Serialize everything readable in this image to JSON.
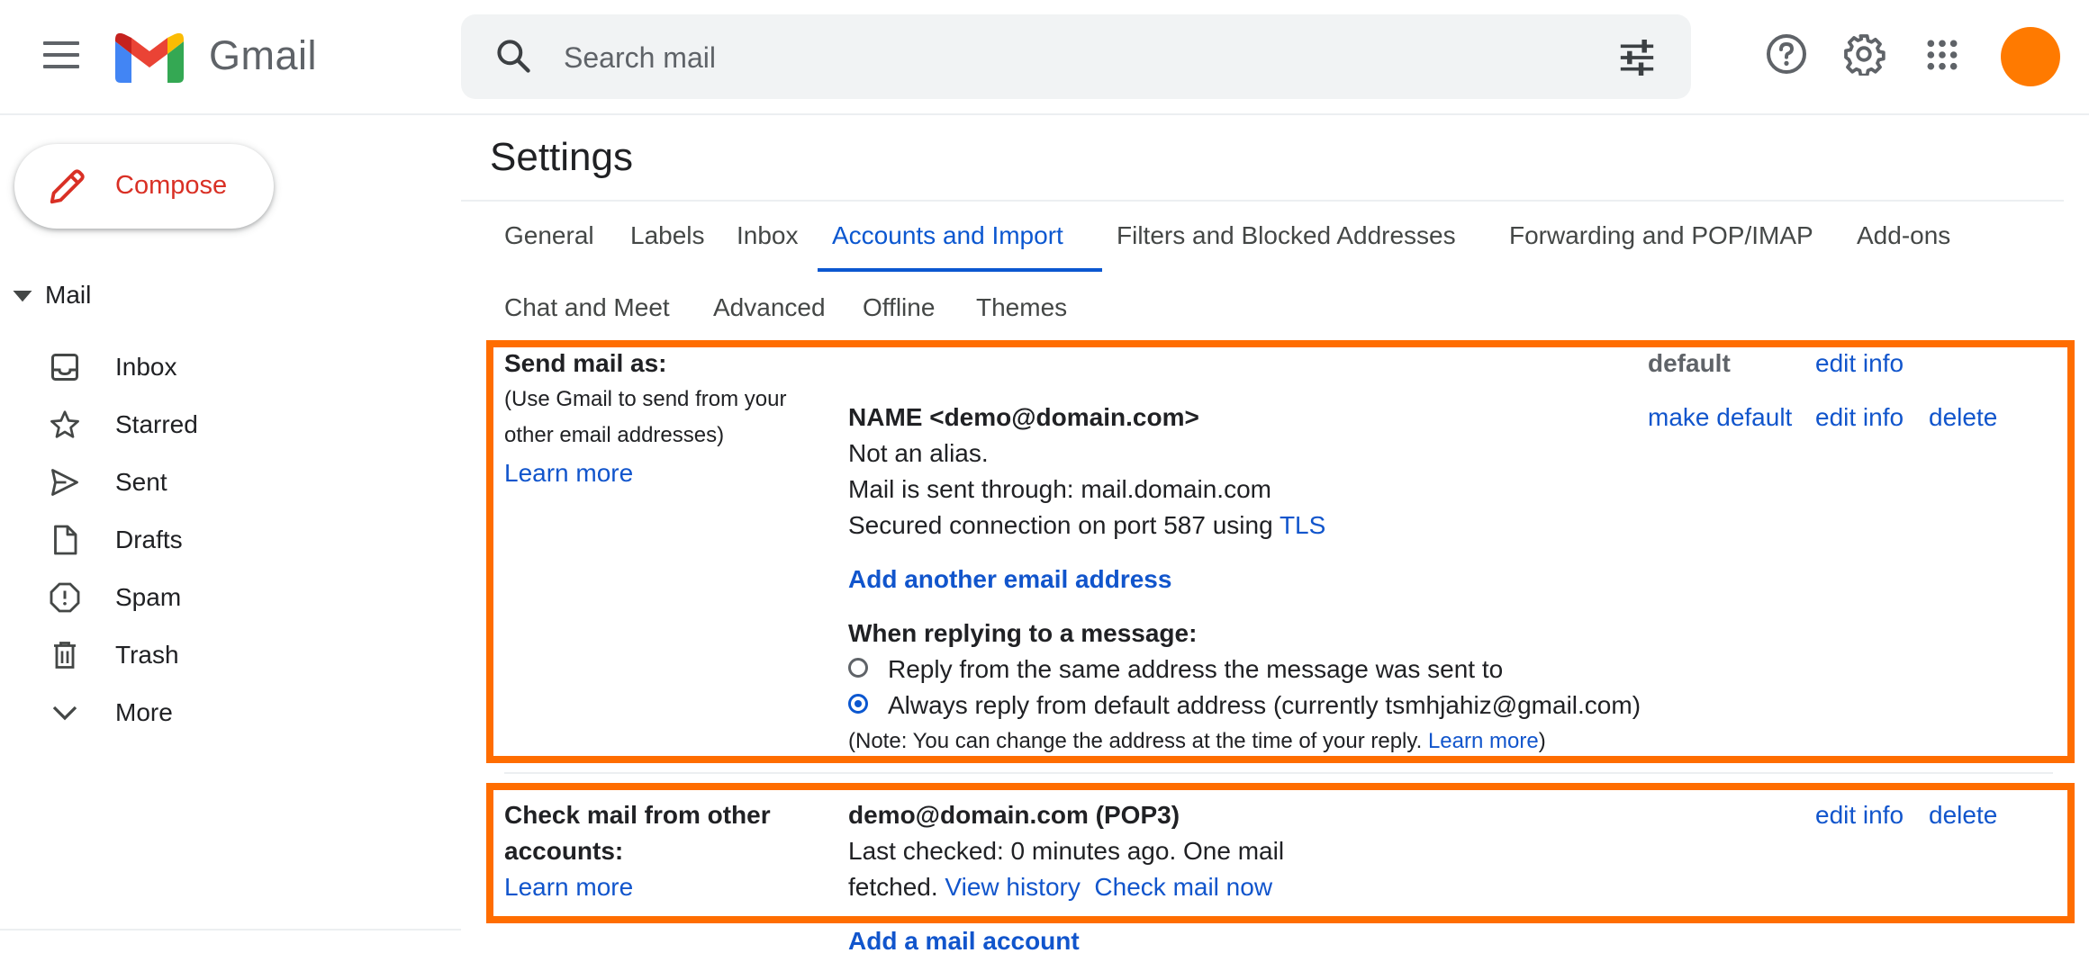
{
  "header": {
    "brand": "Gmail",
    "search_placeholder": "Search mail"
  },
  "sidebar": {
    "compose_label": "Compose",
    "mail_section": "Mail",
    "items": [
      {
        "label": "Inbox",
        "icon": "inbox-icon"
      },
      {
        "label": "Starred",
        "icon": "star-icon"
      },
      {
        "label": "Sent",
        "icon": "send-icon"
      },
      {
        "label": "Drafts",
        "icon": "draft-icon"
      },
      {
        "label": "Spam",
        "icon": "spam-icon"
      },
      {
        "label": "Trash",
        "icon": "trash-icon"
      },
      {
        "label": "More",
        "icon": "chevron-down-icon"
      }
    ]
  },
  "settings": {
    "title": "Settings",
    "tabs": [
      "General",
      "Labels",
      "Inbox",
      "Accounts and Import",
      "Filters and Blocked Addresses",
      "Forwarding and POP/IMAP",
      "Add-ons",
      "Chat and Meet",
      "Advanced",
      "Offline",
      "Themes"
    ],
    "active_tab": "Accounts and Import",
    "send_mail_as": {
      "heading": "Send mail as:",
      "desc_line1": "(Use Gmail to send from your",
      "desc_line2": "other email addresses)",
      "learn_more": "Learn more",
      "default_label": "default",
      "edit_info": "edit info",
      "make_default": "make default",
      "delete": "delete",
      "address_name": "NAME <demo@domain.com>",
      "not_alias": "Not an alias.",
      "sent_through": "Mail is sent through: mail.domain.com",
      "secured": "Secured connection on port 587 using",
      "tls": "TLS",
      "add_another": "Add another email address",
      "reply_heading": "When replying to a message:",
      "reply_option1": "Reply from the same address the message was sent to",
      "reply_option2": "Always reply from default address (currently tsmhjahiz@gmail.com)",
      "note_text": "(Note: You can change the address at the time of your reply.",
      "note_learn_more": "Learn more",
      "note_close": ")"
    },
    "check_mail": {
      "heading_line1": "Check mail from other",
      "heading_line2": "accounts:",
      "learn_more": "Learn more",
      "account": "demo@domain.com (POP3)",
      "last_checked": "Last checked: 0 minutes ago. One mail",
      "fetched": "fetched.",
      "view_history": "View history",
      "check_now": "Check mail now",
      "edit_info": "edit info",
      "delete": "delete",
      "add_account": "Add a mail account"
    }
  },
  "colors": {
    "highlight": "#ff6d00",
    "link": "#1155cc",
    "active_tab": "#0b57d0",
    "compose_text": "#d93025",
    "avatar": "#ff7a00"
  }
}
